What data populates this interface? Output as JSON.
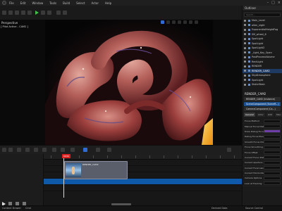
{
  "menu": {
    "items": [
      "File",
      "Edit",
      "Window",
      "Tools",
      "Build",
      "Select",
      "Actor",
      "Help"
    ]
  },
  "viewport": {
    "mode_label": "Perspective",
    "camera_label": "[ Pilot Active - CAM2 ]"
  },
  "outliner": {
    "title": "Outliner",
    "search_placeholder": "Search...",
    "items": [
      {
        "label": "Main_Level",
        "selected": false
      },
      {
        "label": "allen_night",
        "selected": false
      },
      {
        "label": "ExponentialHeightFog",
        "selected": false
      },
      {
        "label": "SM_wheel_6",
        "selected": false
      },
      {
        "label": "SpotLight",
        "selected": false
      },
      {
        "label": "SpotLight",
        "selected": false
      },
      {
        "label": "SpotLight2",
        "selected": false
      },
      {
        "label": "_Light_Key_Open",
        "selected": false
      },
      {
        "label": "PostProcessVolume",
        "selected": false
      },
      {
        "label": "RectLight",
        "selected": false
      },
      {
        "label": "RENDER",
        "selected": false
      },
      {
        "label": "RENDER_CAM2",
        "selected": true
      },
      {
        "label": "SkyAtmosphere",
        "selected": false
      },
      {
        "label": "SpotLight",
        "selected": false
      },
      {
        "label": "StaticMesh",
        "selected": false
      }
    ]
  },
  "details": {
    "title": "RENDER_CAM2",
    "components": [
      {
        "label": "RENDER_CAM2 (Instance)",
        "selected": false
      },
      {
        "label": "SceneComponent (SceneR...)",
        "selected": true
      },
      {
        "label": "CameraComponent (Ca...)",
        "selected": false
      }
    ],
    "tabs": [
      "General",
      "Actor",
      "LOD",
      "Misc",
      "Physics"
    ],
    "properties": [
      "Focus Method",
      "Manual Focus Distance",
      "Draw Debug Focus Pl...",
      "Debug Focus Plane...",
      "Smooth Focus Changes",
      "Focus Smoothing Inte...",
      "Focus Offset",
      "Current Focus Distance",
      "Current Aperture",
      "Current Focal Length",
      "Current Horizontal FOV",
      "Camera Options",
      "Look at Tracking"
    ]
  },
  "timeline": {
    "playhead_frame": "0036",
    "clip_name": "RENDER_CAM2"
  },
  "bottombar": {
    "content_drawer": "Content Drawer",
    "cmd": "Cmd",
    "derived": "Derived Data",
    "source": "Source Control"
  }
}
